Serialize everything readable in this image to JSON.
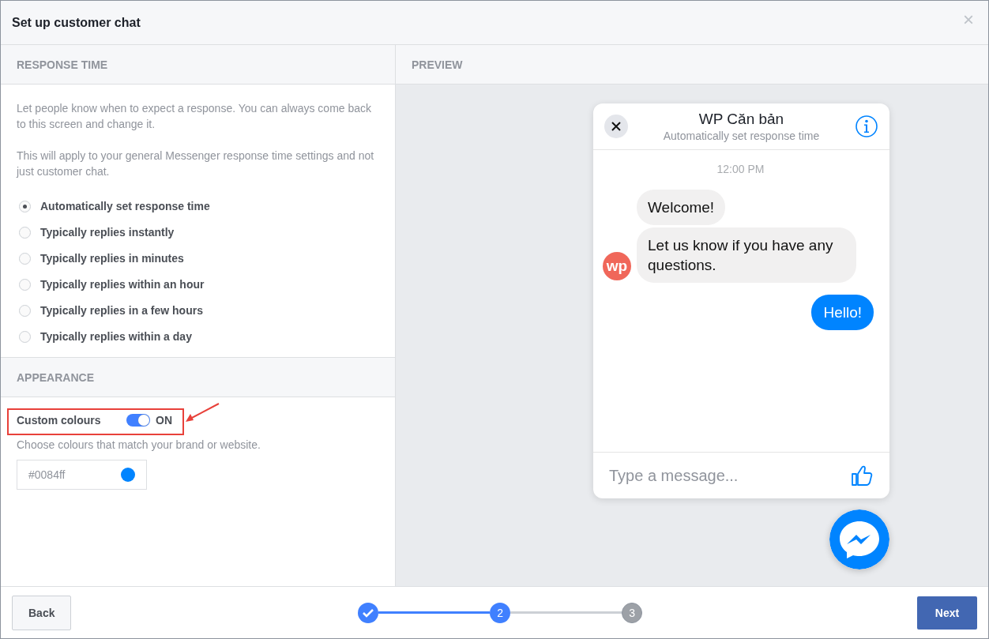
{
  "window": {
    "title": "Set up customer chat",
    "close": "×"
  },
  "response_time": {
    "heading": "RESPONSE TIME",
    "paragraphs": [
      "Let people know when to expect a response. You can always come back to this screen and change it.",
      "This will apply to your general Messenger response time settings and not just customer chat."
    ],
    "options": [
      {
        "label": "Automatically set response time",
        "selected": true
      },
      {
        "label": "Typically replies instantly",
        "selected": false
      },
      {
        "label": "Typically replies in minutes",
        "selected": false
      },
      {
        "label": "Typically replies within an hour",
        "selected": false
      },
      {
        "label": "Typically replies in a few hours",
        "selected": false
      },
      {
        "label": "Typically replies within a day",
        "selected": false
      }
    ]
  },
  "appearance": {
    "heading": "APPEARANCE",
    "custom_colours": {
      "label": "Custom colours",
      "on": true,
      "state_text": "ON"
    },
    "hint": "Choose colours that match your brand or website.",
    "colour_field": {
      "value": "#0084ff",
      "color": "#0084ff"
    }
  },
  "preview": {
    "heading": "PREVIEW",
    "chat": {
      "name": "WP Căn bản",
      "status": "Automatically set response time",
      "time": "12:00 PM",
      "avatar": "wp",
      "messages": [
        {
          "text": "Welcome!",
          "kind": "incoming"
        },
        {
          "text": "Let us know if you have any questions.",
          "kind": "incoming"
        },
        {
          "text": "Hello!",
          "kind": "outgoing"
        }
      ],
      "composer": {
        "placeholder": "Type a message..."
      }
    }
  },
  "footer": {
    "back": "Back",
    "next": "Next",
    "steps": [
      {
        "kind": "done"
      },
      {
        "label": "2",
        "kind": "current"
      },
      {
        "label": "3",
        "kind": "pending"
      }
    ]
  }
}
